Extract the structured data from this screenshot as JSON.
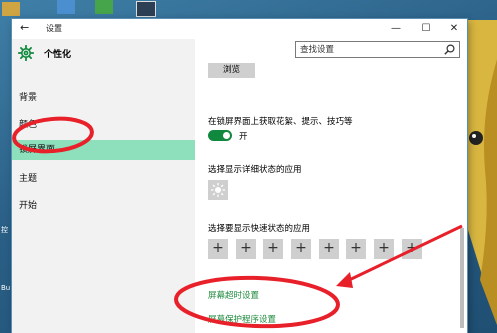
{
  "window": {
    "title": "设置",
    "back_glyph": "←",
    "minimize_glyph": "—",
    "maximize_glyph": "☐",
    "close_glyph": "✕"
  },
  "sidebar": {
    "header": "个性化",
    "header_icon": "gear-icon",
    "items": [
      {
        "label": "背景",
        "selected": false
      },
      {
        "label": "颜色",
        "selected": false
      },
      {
        "label": "锁屏界面",
        "selected": true
      },
      {
        "label": "主题",
        "selected": false
      },
      {
        "label": "开始",
        "selected": false
      }
    ]
  },
  "search": {
    "placeholder": "查找设置",
    "icon": "search-icon"
  },
  "content": {
    "browse_label": "浏览",
    "tips_label": "在锁屏界面上获取花絮、提示、技巧等",
    "toggle_state": "开",
    "toggle_on": true,
    "detail_status_label": "选择显示详细状态的应用",
    "detail_status_icon": "sun-icon",
    "quick_status_label": "选择要显示快速状态的应用",
    "quick_status_slots": [
      "+",
      "+",
      "+",
      "+",
      "+",
      "+",
      "+",
      "+"
    ],
    "links": {
      "screen_timeout": "屏幕超时设置",
      "screensaver": "屏幕保护程序设置"
    }
  },
  "desktop": {
    "left_labels": [
      "控",
      "Bu"
    ]
  },
  "colors": {
    "accent_green": "#10893e",
    "link_green": "#1e8a3c",
    "selection_mint": "#8ee0bd",
    "annotation_red": "#e8202a"
  }
}
